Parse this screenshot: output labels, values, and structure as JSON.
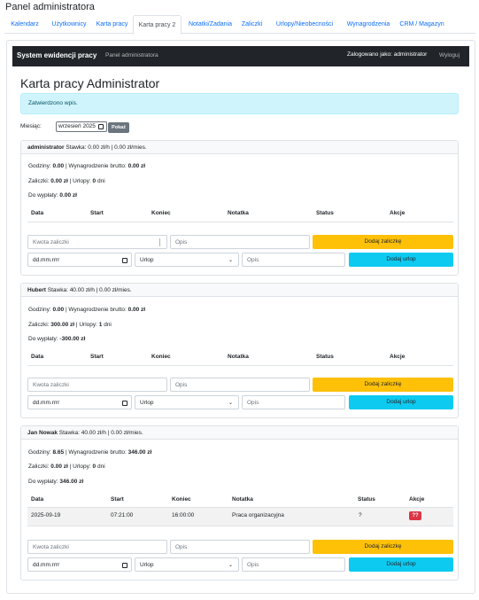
{
  "app": {
    "title": "Panel administratora"
  },
  "tabs": [
    {
      "label": "Kalendarz"
    },
    {
      "label": "Użytkownicy"
    },
    {
      "label": "Karta pracy"
    },
    {
      "label": "Karta pracy 2"
    },
    {
      "label": "Notatki/Zadania"
    },
    {
      "label": "Zaliczki"
    },
    {
      "label": "Urlopy/Nieobecności"
    },
    {
      "label": "Wynagrodzenia"
    },
    {
      "label": "CRM / Magazyn"
    }
  ],
  "navbar": {
    "brand": "System ewidencji pracy",
    "subtitle": "Panel administratora",
    "user_label": "Zalogowano jako: administrator",
    "logout": "Wyloguj"
  },
  "main": {
    "heading": "Karta pracy Administrator",
    "alert": "Zatwierdzono wpis.",
    "month_label": "Miesiąc:",
    "month_value": "wrzesień 2025",
    "show_button": "Pokaż"
  },
  "table_headers": [
    "Data",
    "Start",
    "Koniec",
    "Notatka",
    "Status",
    "Akcje"
  ],
  "form": {
    "advance_placeholder": "Kwota zaliczki",
    "note_placeholder": "Opis",
    "add_advance": "Dodaj zaliczkę",
    "date_placeholder": "dd.mm.rrrr",
    "leave_type": "Urlop",
    "add_leave": "Dodaj urlop"
  },
  "cards": [
    {
      "name": "administrator",
      "rate": "Stawka: 0.00 zł/h | 0.00 zł/mies.",
      "hours_label": "Godziny:",
      "hours": "0.00",
      "gross_label": "| Wynagrodzenie brutto:",
      "gross": "0.00 zł",
      "advances_label": "Zaliczki:",
      "advances": "0.00 zł",
      "leave_label": "| Urlopy:",
      "leave": "0",
      "leave_unit": "dni",
      "payout_label": "Do wypłaty:",
      "payout": "0.00 zł",
      "rows": []
    },
    {
      "name": "Hubert",
      "rate": "Stawka: 40.00 zł/h | 0.00 zł/mies.",
      "hours_label": "Godziny:",
      "hours": "0.00",
      "gross_label": "| Wynagrodzenie brutto:",
      "gross": "0.00 zł",
      "advances_label": "Zaliczki:",
      "advances": "300.00 zł",
      "leave_label": "| Urlopy:",
      "leave": "1",
      "leave_unit": "dni",
      "payout_label": "Do wypłaty:",
      "payout": "-300.00 zł",
      "rows": []
    },
    {
      "name": "Jan Nowak",
      "rate": "Stawka: 40.00 zł/h | 0.00 zł/mies.",
      "hours_label": "Godziny:",
      "hours": "8.65",
      "gross_label": "| Wynagrodzenie brutto:",
      "gross": "346.00 zł",
      "advances_label": "Zaliczki:",
      "advances": "0.00 zł",
      "leave_label": "| Urlopy:",
      "leave": "0",
      "leave_unit": "dni",
      "payout_label": "Do wypłaty:",
      "payout": "346.00 zł",
      "rows": [
        {
          "date": "2025-09-19",
          "start": "07:21:00",
          "end": "16:00:00",
          "note": "Praca organizacyjna",
          "status": "?",
          "action": "??"
        }
      ]
    }
  ],
  "colors": {
    "navbar": "#212529",
    "link": "#0d6efd",
    "alert_bg": "#cff4fc",
    "warning": "#ffc107",
    "info": "#0dcaf0",
    "danger": "#dc3545"
  }
}
